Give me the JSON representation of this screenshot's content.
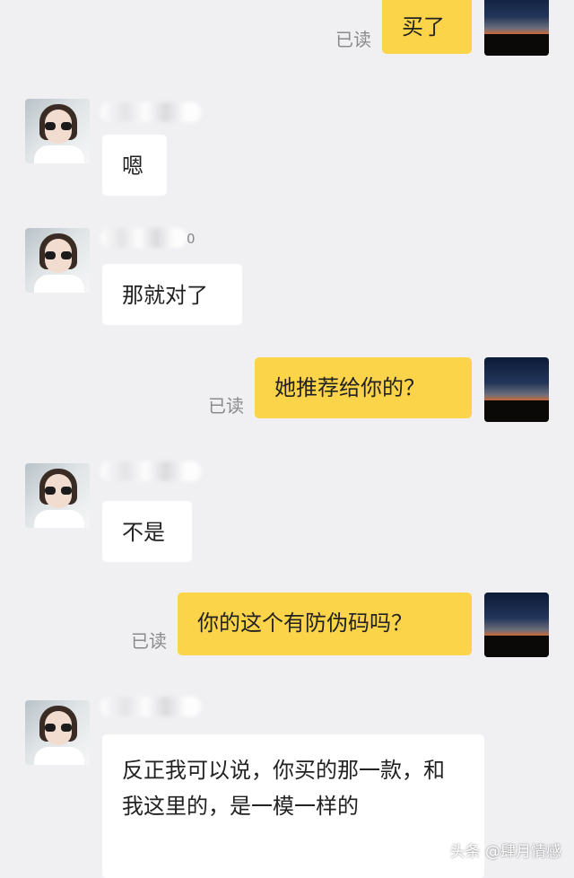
{
  "read_label": "已读",
  "messages": [
    {
      "side": "right",
      "text": "买了"
    },
    {
      "side": "left",
      "text": "嗯",
      "name_tail": ""
    },
    {
      "side": "left",
      "text": "那就对了",
      "name_tail": "0"
    },
    {
      "side": "right",
      "text": "她推荐给你的？"
    },
    {
      "side": "left",
      "text": "不是",
      "name_tail": ""
    },
    {
      "side": "right",
      "text": "你的这个有防伪码吗？"
    },
    {
      "side": "left",
      "text": "反正我可以说，你买的那一款，和我这里的，是一模一样的",
      "name_tail": ""
    }
  ],
  "watermark": "头条 @肆月情感",
  "colors": {
    "background": "#f0f0f3",
    "bubble_self": "#fcd44a",
    "bubble_other": "#ffffff"
  },
  "icons": {
    "avatar_other": "woman-sunglasses-avatar",
    "avatar_self": "sunset-avatar"
  }
}
